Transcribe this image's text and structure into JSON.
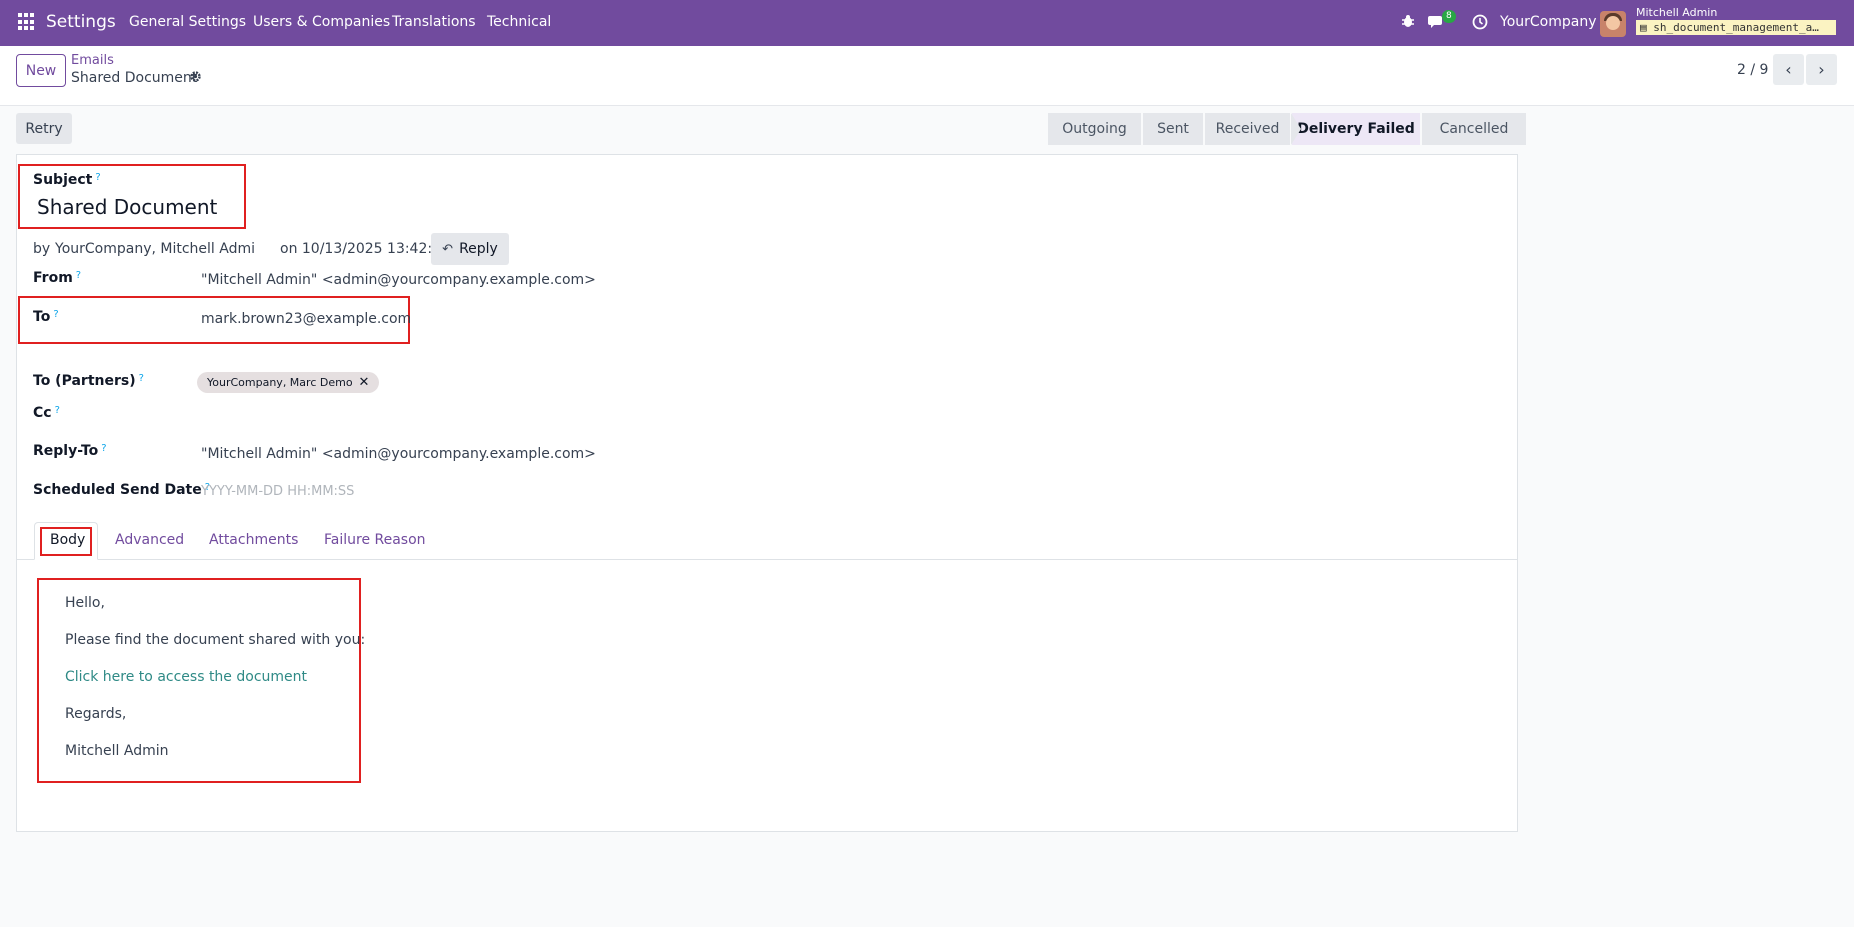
{
  "navbar": {
    "brand": "Settings",
    "menu": [
      "General Settings",
      "Users & Companies",
      "Translations",
      "Technical"
    ],
    "message_count": "8",
    "company": "YourCompany",
    "user_name": "Mitchell Admin",
    "database": "sh_document_management_a…"
  },
  "control": {
    "new_label": "New",
    "breadcrumb_parent": "Emails",
    "breadcrumb_current": "Shared Document",
    "pager": "2 / 9"
  },
  "actions": {
    "retry_label": "Retry"
  },
  "statusbar": {
    "stages": [
      "Outgoing",
      "Sent",
      "Received",
      "Delivery Failed",
      "Cancelled"
    ],
    "active": "Delivery Failed"
  },
  "form": {
    "subject_label": "Subject",
    "subject": "Shared Document",
    "by_prefix": "by",
    "author": "YourCompany, Mitchell Admi",
    "date": "on 10/13/2025 13:42:10",
    "reply_label": "Reply",
    "from_label": "From",
    "from": "\"Mitchell Admin\" <admin@yourcompany.example.com>",
    "to_label": "To",
    "to": "mark.brown23@example.com",
    "to_partners_label": "To (Partners)",
    "to_partners_tag": "YourCompany, Marc Demo",
    "cc_label": "Cc",
    "reply_to_label": "Reply-To",
    "reply_to": "\"Mitchell Admin\" <admin@yourcompany.example.com>",
    "scheduled_label": "Scheduled Send Date",
    "scheduled_placeholder": "YYYY-MM-DD HH:MM:SS",
    "help_mark": "?"
  },
  "tabs": [
    "Body",
    "Advanced",
    "Attachments",
    "Failure Reason"
  ],
  "body": {
    "greeting": "Hello,",
    "line1": "Please find the document shared with you:",
    "link": "Click here to access the document",
    "regards": "Regards,",
    "signature": "Mitchell Admin"
  },
  "colors": {
    "navbar": "#714b9e",
    "highlight_box": "#e02020",
    "link": "#2f8a86"
  },
  "icons": [
    "apps-icon",
    "bug-icon",
    "chat-icon",
    "clock-icon",
    "gear-icon",
    "chevron-left-icon",
    "chevron-right-icon",
    "reply-icon",
    "close-icon"
  ]
}
